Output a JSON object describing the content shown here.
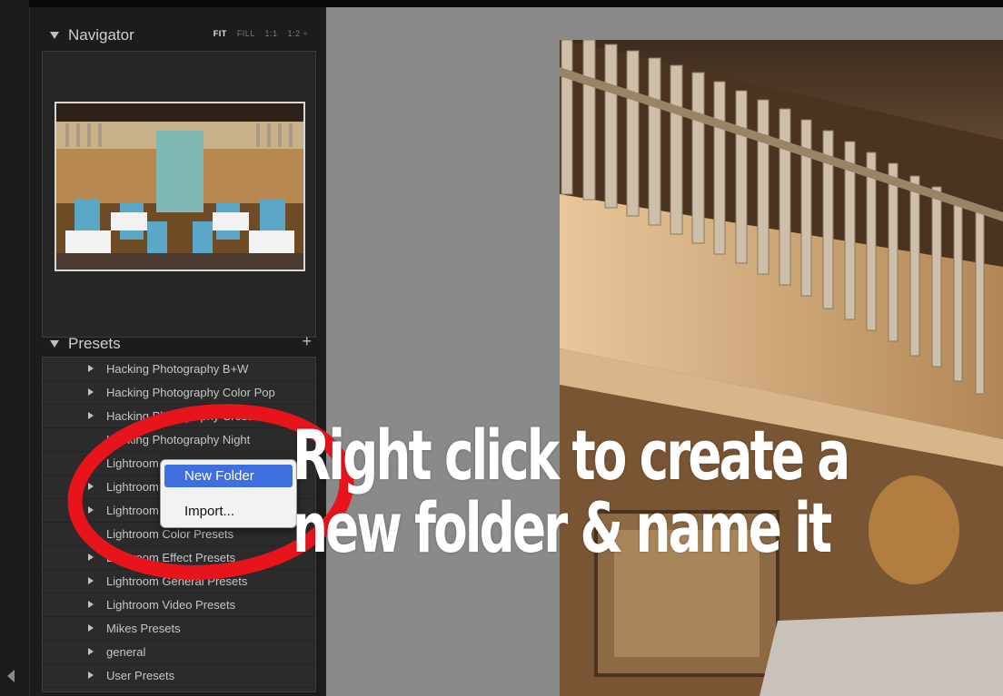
{
  "navigator": {
    "title": "Navigator",
    "zoom_options": [
      "FIT",
      "FILL",
      "1:1",
      "1:2 ÷"
    ]
  },
  "presets": {
    "title": "Presets",
    "add_icon": "plus-icon",
    "items": [
      {
        "label": "Hacking Photography B+W",
        "arrow": true
      },
      {
        "label": "Hacking Photography Color Pop",
        "arrow": true
      },
      {
        "label": "Hacking Photography Cross",
        "arrow": true
      },
      {
        "label": "Hacking Photography Night",
        "arrow": false
      },
      {
        "label": "Lightroom",
        "arrow": true
      },
      {
        "label": "Lightroom",
        "arrow": true
      },
      {
        "label": "Lightroom",
        "arrow": true
      },
      {
        "label": "Lightroom Color Presets",
        "arrow": false
      },
      {
        "label": "Lightroom Effect Presets",
        "arrow": true
      },
      {
        "label": "Lightroom General Presets",
        "arrow": true
      },
      {
        "label": "Lightroom Video Presets",
        "arrow": true
      },
      {
        "label": "Mikes Presets",
        "arrow": true
      },
      {
        "label": "general",
        "arrow": true
      },
      {
        "label": "User Presets",
        "arrow": true
      }
    ]
  },
  "context_menu": {
    "items": [
      {
        "label": "New Folder",
        "highlighted": true
      },
      {
        "label": "Import...",
        "highlighted": false
      }
    ]
  },
  "caption": {
    "line1": "Right click to create a",
    "line2": "new folder & name it"
  },
  "colors": {
    "highlight": "#3f6fde",
    "annotation": "#e8141c",
    "panel_bg": "#1c1c1c"
  }
}
